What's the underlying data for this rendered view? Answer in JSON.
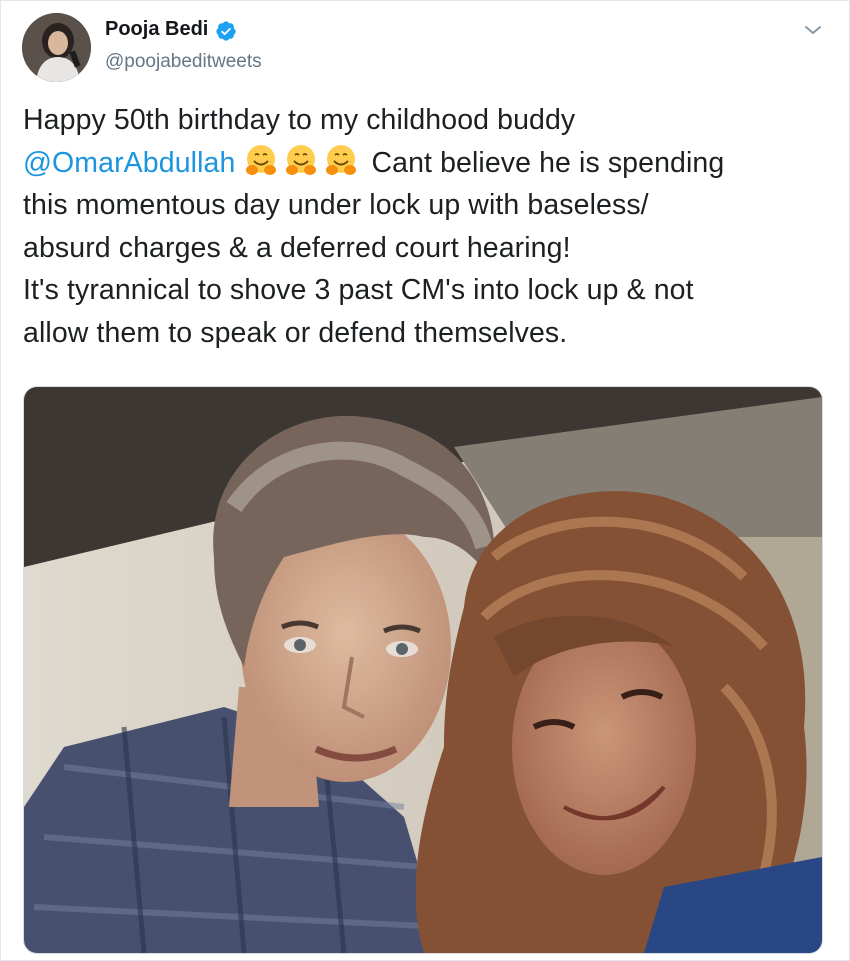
{
  "user": {
    "display_name": "Pooja Bedi",
    "handle": "@poojabeditweets",
    "verified": true,
    "avatar_icon": "profile-photo"
  },
  "menu": {
    "icon": "chevron-down-icon"
  },
  "tweet": {
    "line1": "Happy 50th birthday to my childhood buddy",
    "mention": "@OmarAbdullah",
    "emoji_name": "hugging-face-emoji",
    "line2_rest": " Cant believe he is  spending",
    "line3": "this momentous day under lock up with baseless/",
    "line4": "absurd charges & a deferred court hearing!",
    "line5": "It's tyrannical to shove 3 past CM's into lock up & not",
    "line6": "allow them to speak or defend themselves."
  },
  "media": {
    "type": "photo",
    "description_icon": "photo-of-two-people"
  },
  "colors": {
    "link": "#1b95e0",
    "verified": "#1da1f2",
    "secondary_text": "#657786",
    "primary_text": "#14171a"
  }
}
